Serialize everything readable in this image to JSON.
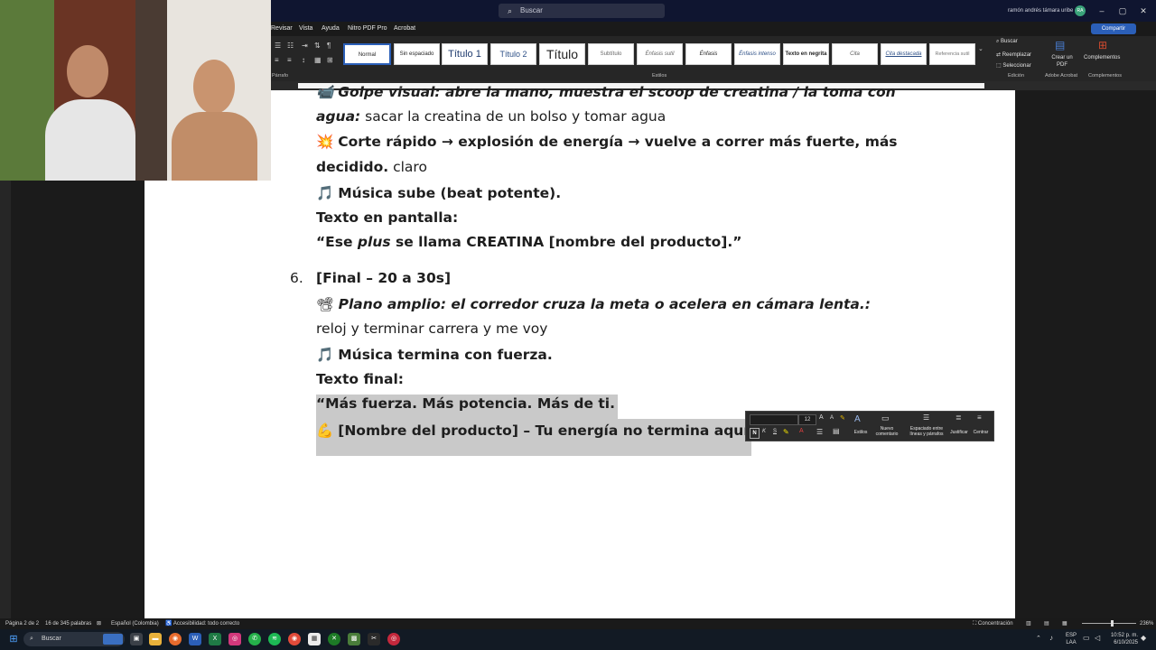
{
  "search": {
    "placeholder": "Buscar"
  },
  "account": {
    "user_name": "ramón andrés támara uribe",
    "initials": "RA"
  },
  "window_controls": {
    "minimize": "–",
    "maximize": "▢",
    "close": "✕"
  },
  "menu": {
    "items": [
      "Revisar",
      "Vista",
      "Ayuda",
      "Nitro PDF Pro",
      "Acrobat"
    ],
    "share": "Compartir"
  },
  "ribbon": {
    "styles": [
      "Normal",
      "Sin espaciado",
      "Título 1",
      "Título 2",
      "Título",
      "Subtítulo",
      "Énfasis sutil",
      "Énfasis",
      "Énfasis intenso",
      "Texto en negrita",
      "Cita",
      "Cita destacada",
      "Referencia sutil"
    ],
    "group_labels": {
      "paragraph": "Párrafo",
      "styles": "Estilos",
      "editing": "Edición",
      "adobe": "Adobe Acrobat",
      "addins": "Complementos"
    },
    "editing": {
      "find": "Buscar",
      "replace": "Reemplazar",
      "select": "Seleccionar"
    },
    "adobe_button": "Crear un PDF",
    "addins_button": "Complementos"
  },
  "document": {
    "line1_emoji": "📹",
    "line1_bold": "Golpe visual: abre la mano, muestra el scoop de creatina / la toma con",
    "line2_bold": "agua:",
    "line2_text": " sacar la creatina de un bolso y tomar agua",
    "line3_emoji": "💥",
    "line3_bold": "Corte rápido → explosión de energía → vuelve a correr más fuerte, más",
    "line4_bold": "decidido.",
    "line4_text": " claro",
    "line5_emoji": "🎵",
    "line5_bold": "Música sube (beat potente).",
    "line6": "Texto en pantalla:",
    "line7_a": "“Ese ",
    "line7_em": "plus",
    "line7_b": " se llama CREATINA [nombre del producto].”",
    "list_number": "6.",
    "list_title": "[Final – 20 a 30s]",
    "line8_emoji": "📽",
    "line8_bold": "Plano amplio: el corredor cruza la meta o acelera en cámara lenta.:",
    "line9": "reloj y terminar carrera y me voy",
    "line10_emoji": "🎵",
    "line10_bold": "Música termina con fuerza.",
    "line11": "Texto final:",
    "line12": "“Más fuerza. Más potencia. Más de ti.",
    "line13_emoji": "💪",
    "line13_bold": "[Nombre del producto] – Tu energía no termina aquí.”"
  },
  "mini_toolbar": {
    "font_size": "12",
    "styles_label": "Estilos",
    "new_comment": "Nuevo comentario",
    "spacing": "Espaciado entre líneas y párrafos",
    "justify": "Justificar",
    "center": "Centrar"
  },
  "statusbar": {
    "page": "Página 2 de 2",
    "words": "16 de 345 palabras",
    "language": "Español (Colombia)",
    "accessibility": "Accesibilidad: todo correcto",
    "focus": "Concentración",
    "zoom": "236%"
  },
  "taskbar": {
    "search": "Buscar",
    "lang": "ESP",
    "lang_sub": "LAA",
    "time": "10:52 p. m.",
    "date": "6/10/2025"
  },
  "colors": {
    "word_blue": "#2b5fb8",
    "selection": "#c9c9c9",
    "titlebar": "#0f1530"
  }
}
